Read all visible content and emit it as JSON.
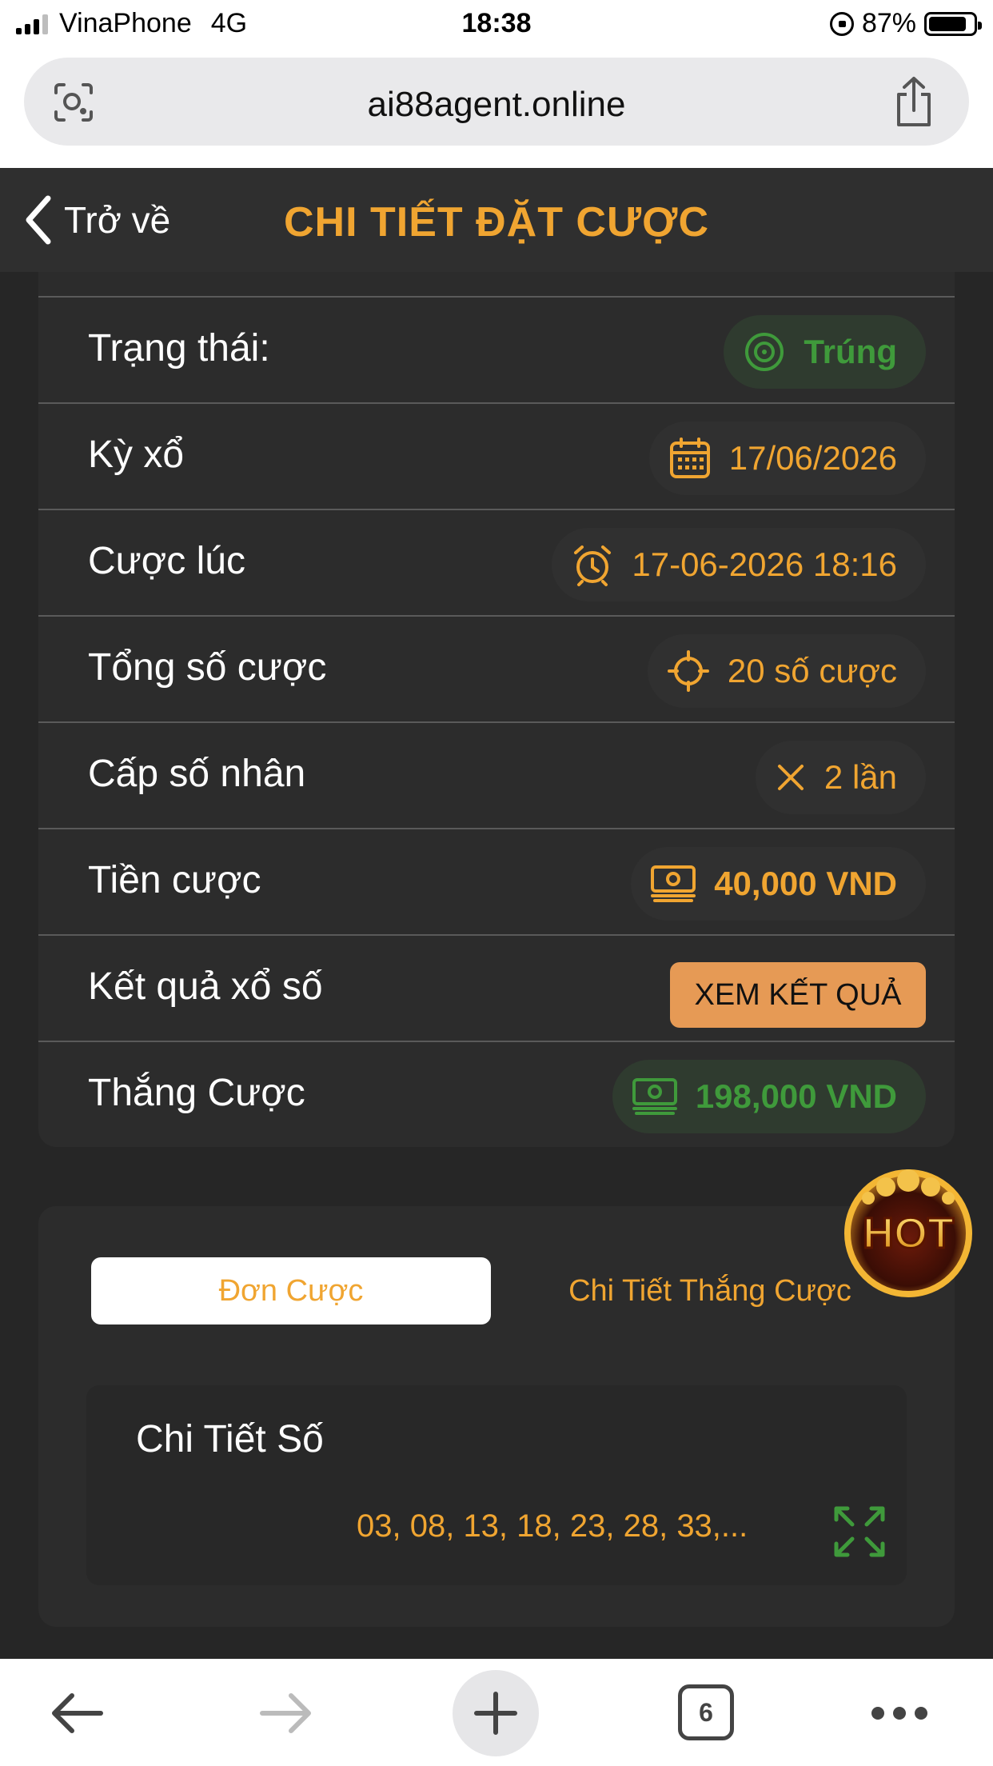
{
  "status_bar": {
    "carrier": "VinaPhone",
    "network": "4G",
    "time": "18:38",
    "battery": "87%"
  },
  "browser": {
    "url": "ai88agent.online",
    "tabs_count": "6"
  },
  "header": {
    "back_label": "Trở về",
    "title": "CHI TIẾT ĐẶT CƯỢC"
  },
  "details": {
    "status": {
      "label": "Trạng thái:",
      "value": "Trúng",
      "icon": "target-icon"
    },
    "draw": {
      "label": "Kỳ xổ",
      "value": "17/06/2026",
      "icon": "calendar-icon"
    },
    "bet_time": {
      "label": "Cược lúc",
      "value": "17-06-2026 18:16",
      "icon": "alarm-clock-icon"
    },
    "total_bets": {
      "label": "Tổng số cược",
      "value": "20 số cược",
      "icon": "crosshair-icon"
    },
    "multiplier": {
      "label": "Cấp số nhân",
      "value": "2 lần",
      "icon": "multiply-icon"
    },
    "stake": {
      "label": "Tiền cược",
      "value": "40,000 VND",
      "icon": "money-icon"
    },
    "lottery_result": {
      "label": "Kết quả xổ số",
      "button": "XEM KẾT QUẢ"
    },
    "winnings": {
      "label": "Thắng Cược",
      "value": "198,000 VND",
      "icon": "money-icon"
    }
  },
  "tabs": {
    "active": "Đơn Cược",
    "inactive": "Chi Tiết Thắng Cược"
  },
  "numbers": {
    "title": "Chi Tiết Số",
    "value": "03, 08, 13, 18, 23, 28, 33,..."
  },
  "badge": {
    "text": "HOT"
  },
  "colors": {
    "accent": "#f0a531",
    "win_green": "#3f9a3b",
    "button": "#e69a55",
    "background": "#262626"
  }
}
